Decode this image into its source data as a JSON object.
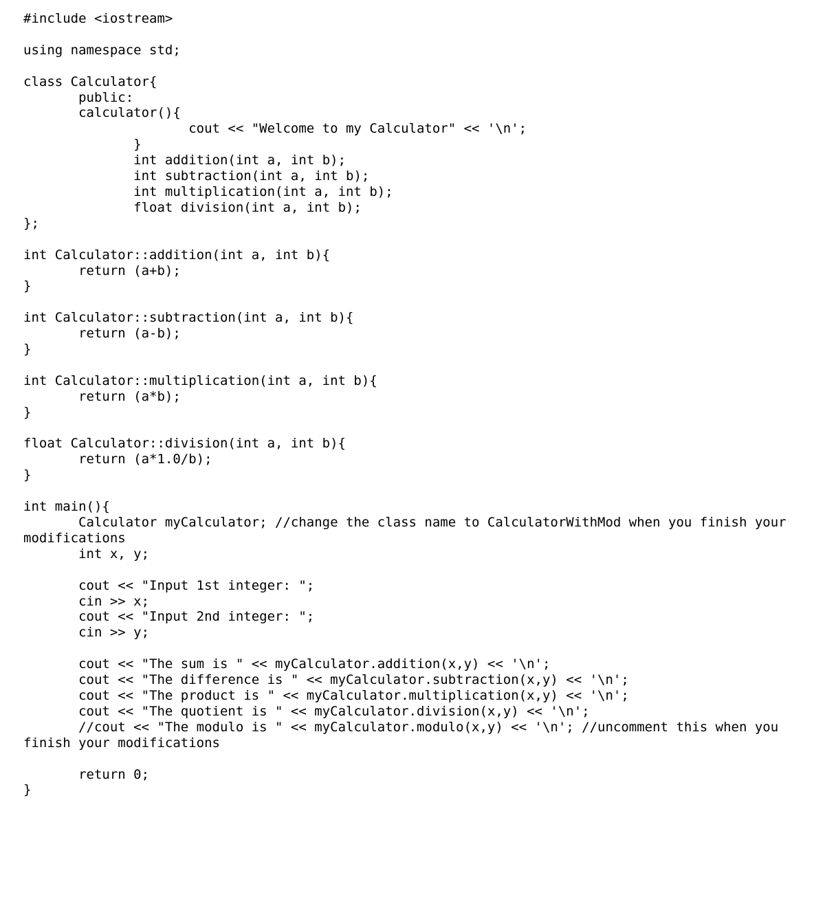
{
  "code_text": "#include <iostream>\n\nusing namespace std;\n\nclass Calculator{\n       public:\n       calculator(){\n                     cout << \"Welcome to my Calculator\" << '\\n';\n              }\n              int addition(int a, int b);\n              int subtraction(int a, int b);\n              int multiplication(int a, int b);\n              float division(int a, int b);\n};\n\nint Calculator::addition(int a, int b){\n       return (a+b);\n}\n\nint Calculator::subtraction(int a, int b){\n       return (a-b);\n}\n\nint Calculator::multiplication(int a, int b){\n       return (a*b);\n}\n\nfloat Calculator::division(int a, int b){\n       return (a*1.0/b);\n}\n\nint main(){\n       Calculator myCalculator; //change the class name to CalculatorWithMod when you finish your modifications\n       int x, y;\n\n       cout << \"Input 1st integer: \";\n       cin >> x;\n       cout << \"Input 2nd integer: \";\n       cin >> y;\n\n       cout << \"The sum is \" << myCalculator.addition(x,y) << '\\n';\n       cout << \"The difference is \" << myCalculator.subtraction(x,y) << '\\n';\n       cout << \"The product is \" << myCalculator.multiplication(x,y) << '\\n';\n       cout << \"The quotient is \" << myCalculator.division(x,y) << '\\n';\n       //cout << \"The modulo is \" << myCalculator.modulo(x,y) << '\\n'; //uncomment this when you finish your modifications\n\n       return 0;\n}"
}
